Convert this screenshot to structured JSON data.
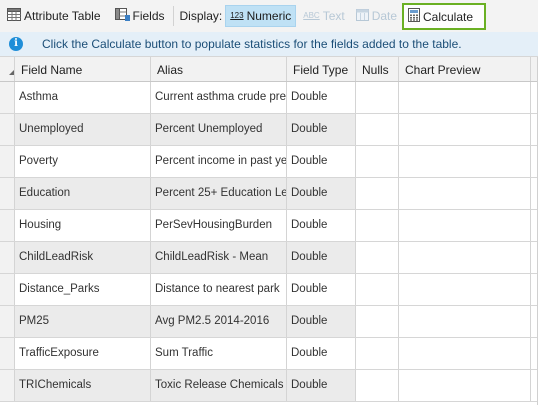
{
  "toolbar": {
    "attribute_table_label": "Attribute Table",
    "fields_label": "Fields",
    "display_label": "Display:",
    "numeric_label": "Numeric",
    "numeric_badge": "123",
    "text_label": "Text",
    "text_badge": "ABC",
    "date_label": "Date",
    "calculate_label": "Calculate"
  },
  "info": {
    "message": "Click the Calculate button to populate statistics for the fields added to the table."
  },
  "table": {
    "columns": [
      "Field Name",
      "Alias",
      "Field Type",
      "Nulls",
      "Chart Preview"
    ],
    "rows": [
      {
        "name": "Asthma",
        "alias": "Current asthma crude pre",
        "type": "Double"
      },
      {
        "name": "Unemployed",
        "alias": "Percent Unemployed",
        "type": "Double"
      },
      {
        "name": "Poverty",
        "alias": "Percent income in past ye",
        "type": "Double"
      },
      {
        "name": "Education",
        "alias": "Percent 25+ Education Le",
        "type": "Double"
      },
      {
        "name": "Housing",
        "alias": "PerSevHousingBurden",
        "type": "Double"
      },
      {
        "name": "ChildLeadRisk",
        "alias": "ChildLeadRisk - Mean",
        "type": "Double"
      },
      {
        "name": "Distance_Parks",
        "alias": "Distance to nearest park",
        "type": "Double"
      },
      {
        "name": "PM25",
        "alias": "Avg PM2.5 2014-2016",
        "type": "Double"
      },
      {
        "name": "TrafficExposure",
        "alias": "Sum Traffic",
        "type": "Double"
      },
      {
        "name": "TRIChemicals",
        "alias": "Toxic Release Chemicals (",
        "type": "Double"
      }
    ]
  },
  "colors": {
    "calculate_highlight": "#6ab023",
    "numeric_active": "#bfe1f5",
    "info_bar": "#e4eff8",
    "info_icon": "#1f8ed8"
  }
}
